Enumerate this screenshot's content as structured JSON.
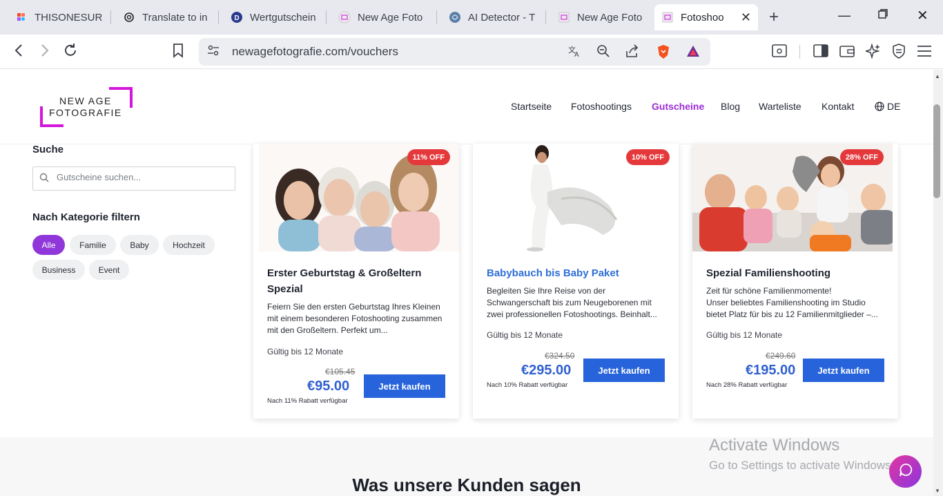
{
  "browser": {
    "tabs": [
      {
        "title": "THISONESURE",
        "icon": "figma-icon"
      },
      {
        "title": "Translate to in",
        "icon": "openai-icon"
      },
      {
        "title": "Wertgutschein",
        "icon": "d-icon"
      },
      {
        "title": "New Age Foto",
        "icon": "nafoto-icon"
      },
      {
        "title": "AI Detector - T",
        "icon": "brain-icon"
      },
      {
        "title": "New Age Foto",
        "icon": "nafoto-icon"
      },
      {
        "title": "Fotoshoo",
        "icon": "nafoto-icon"
      }
    ],
    "url": "newagefotografie.com/vouchers"
  },
  "site": {
    "logo_line1": "NEW AGE",
    "logo_line2": "FOTOGRAFIE",
    "accent": "#d415dc",
    "nav": [
      "Startseite",
      "Fotoshootings",
      "Gutscheine",
      "Blog",
      "Warteliste",
      "Kontakt",
      "DE"
    ]
  },
  "sidebar": {
    "search_heading": "Suche",
    "search_placeholder": "Gutscheine suchen...",
    "filter_heading": "Nach Kategorie filtern",
    "chips": [
      "Alle",
      "Familie",
      "Baby",
      "Hochzeit",
      "Business",
      "Event"
    ]
  },
  "cards": [
    {
      "badge": "11% OFF",
      "title": "Erster Geburtstag & Großeltern Spezial",
      "desc": "Feiern Sie den ersten Geburtstag Ihres Kleinen mit einem besonderen Fotoshooting zusammen mit den Großeltern. Perfekt um...",
      "validity": "Gültig bis 12 Monate",
      "old_price": "€105.45",
      "new_price": "€95.00",
      "note": "Nach 11% Rabatt verfügbar",
      "button": "Jetzt kaufen"
    },
    {
      "badge": "10% OFF",
      "title": "Babybauch bis Baby Paket",
      "desc": "Begleiten Sie Ihre Reise von der Schwangerschaft bis zum Neugeborenen mit zwei professionellen Fotoshootings. Beinhalt...",
      "validity": "Gültig bis 12 Monate",
      "old_price": "€324.50",
      "new_price": "€295.00",
      "note": "Nach 10% Rabatt verfügbar",
      "button": "Jetzt kaufen"
    },
    {
      "badge": "28% OFF",
      "title": "Spezial Familienshooting",
      "desc_line1": "Zeit für schöne Familienmomente!",
      "desc_line2": "Unser beliebtes Familienshooting im Studio bietet Platz für bis zu 12 Familienmitglieder –...",
      "validity": "Gültig bis 12 Monate",
      "old_price": "€249.60",
      "new_price": "€195.00",
      "note": "Nach 28% Rabatt verfügbar",
      "button": "Jetzt kaufen"
    }
  ],
  "section_heading": "Was unsere Kunden sagen",
  "watermark": {
    "title": "Activate Windows",
    "subtitle": "Go to Settings to activate Windows."
  }
}
